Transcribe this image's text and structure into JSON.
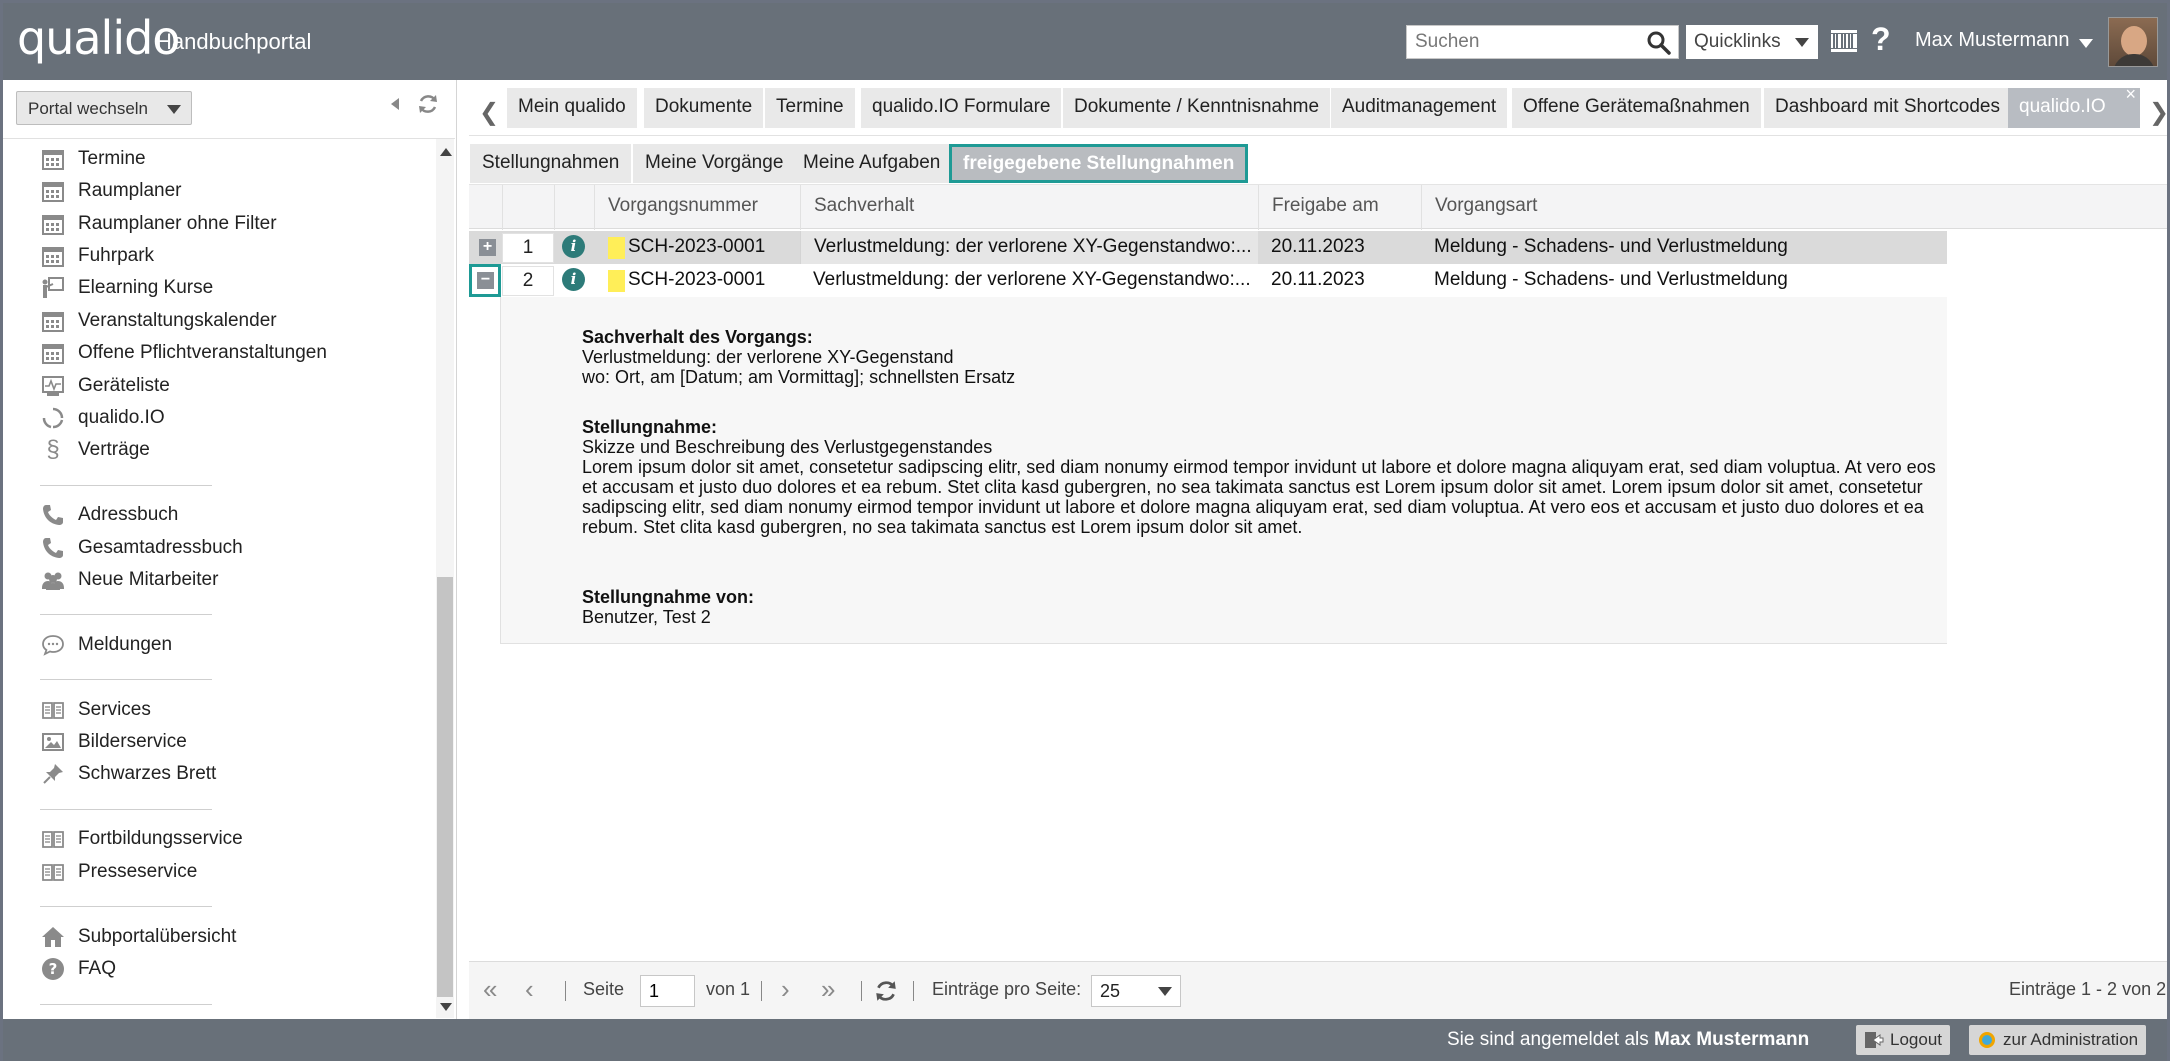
{
  "header": {
    "logo": "qualido",
    "portal_name": "Handbuchportal",
    "search_placeholder": "Suchen",
    "quicklinks_label": "Quicklinks",
    "help_label": "?",
    "user_name": "Max Mustermann"
  },
  "sidebar": {
    "portal_switch_label": "Portal wechseln",
    "items": [
      {
        "label": "Termine",
        "icon": "calendar-icon"
      },
      {
        "label": "Raumplaner",
        "icon": "calendar-icon"
      },
      {
        "label": "Raumplaner ohne Filter",
        "icon": "calendar-icon"
      },
      {
        "label": "Fuhrpark",
        "icon": "calendar-icon"
      },
      {
        "label": "Elearning Kurse",
        "icon": "presentation-icon"
      },
      {
        "label": "Veranstaltungskalender",
        "icon": "calendar-icon"
      },
      {
        "label": "Offene Pflichtveranstaltungen",
        "icon": "calendar-icon"
      },
      {
        "label": "Geräteliste",
        "icon": "monitor-icon"
      },
      {
        "label": "qualido.IO",
        "icon": "circle-arrows-icon"
      },
      {
        "label": "Verträge",
        "icon": "paragraph-icon"
      },
      {
        "label": "Adressbuch",
        "icon": "phone-icon"
      },
      {
        "label": "Gesamtadressbuch",
        "icon": "phone-icon"
      },
      {
        "label": "Neue Mitarbeiter",
        "icon": "people-icon"
      },
      {
        "label": "Meldungen",
        "icon": "chat-bubble-icon"
      },
      {
        "label": "Services",
        "icon": "book-icon"
      },
      {
        "label": "Bilderservice",
        "icon": "image-icon"
      },
      {
        "label": "Schwarzes Brett",
        "icon": "pin-icon"
      },
      {
        "label": "Fortbildungsservice",
        "icon": "book-icon"
      },
      {
        "label": "Presseservice",
        "icon": "book-icon"
      },
      {
        "label": "Subportalübersicht",
        "icon": "home-icon"
      },
      {
        "label": "FAQ",
        "icon": "question-circle-icon"
      }
    ]
  },
  "tabs": [
    {
      "label": "Mein qualido"
    },
    {
      "label": "Dokumente"
    },
    {
      "label": "Termine"
    },
    {
      "label": "qualido.IO Formulare"
    },
    {
      "label": "Dokumente / Kenntnisnahme"
    },
    {
      "label": "Auditmanagement"
    },
    {
      "label": "Offene Gerätemaßnahmen"
    },
    {
      "label": "Dashboard mit Shortcodes"
    },
    {
      "label": "qualido.IO",
      "active": true
    }
  ],
  "subtabs": [
    {
      "label": "Stellungnahmen"
    },
    {
      "label": "Meine Vorgänge"
    },
    {
      "label": "Meine Aufgaben"
    },
    {
      "label": "freigegebene Stellungnahmen",
      "active": true
    }
  ],
  "grid": {
    "columns": [
      "Vorgangsnummer",
      "Sachverhalt",
      "Freigabe am",
      "Vorgangsart"
    ],
    "rows": [
      {
        "num": "1",
        "vorgangsnummer": "SCH-2023-0001",
        "sachverhalt": "Verlustmeldung: der verlorene XY-Gegenstandwo:...",
        "freigabe": "20.11.2023",
        "vorgangsart": "Meldung - Schadens- und Verlustmeldung",
        "expanded": false
      },
      {
        "num": "2",
        "vorgangsnummer": "SCH-2023-0001",
        "sachverhalt": "Verlustmeldung: der verlorene XY-Gegenstandwo:...",
        "freigabe": "20.11.2023",
        "vorgangsart": "Meldung - Schadens- und Verlustmeldung",
        "expanded": true
      }
    ],
    "expand_symbol": "+",
    "collapse_symbol": "−",
    "info_symbol": "i",
    "detail": {
      "sachverhalt_label": "Sachverhalt des Vorgangs:",
      "sachverhalt_line1": "Verlustmeldung: der verlorene XY-Gegenstand",
      "sachverhalt_line2": "wo: Ort, am [Datum; am Vormittag]; schnellsten Ersatz",
      "stellungnahme_label": "Stellungnahme:",
      "stellungnahme_line1": "Skizze und Beschreibung des Verlustgegenstandes",
      "stellungnahme_body": "Lorem ipsum dolor sit amet, consetetur sadipscing elitr, sed diam nonumy eirmod tempor invidunt ut labore et dolore magna aliquyam erat, sed diam voluptua. At vero eos et accusam et justo duo dolores et ea rebum. Stet clita kasd gubergren, no sea takimata sanctus est Lorem ipsum dolor sit amet. Lorem ipsum dolor sit amet, consetetur sadipscing elitr, sed diam nonumy eirmod tempor invidunt ut labore et dolore magna aliquyam erat, sed diam voluptua. At vero eos et accusam et justo duo dolores et ea rebum. Stet clita kasd gubergren, no sea takimata sanctus est Lorem ipsum dolor sit amet.",
      "von_label": "Stellungnahme von:",
      "von_value": "Benutzer, Test 2"
    }
  },
  "pager": {
    "first": "«",
    "prev": "‹",
    "next": "›",
    "last": "»",
    "seite_label": "Seite",
    "page_value": "1",
    "von_label": "von 1",
    "eintraege_label": "Einträge pro Seite:",
    "per_page_value": "25",
    "summary": "Einträge 1 - 2 von 2"
  },
  "footer": {
    "logged_in_prefix": "Sie sind angemeldet als",
    "logged_in_user": "Max Mustermann",
    "logout_label": "Logout",
    "admin_label": "zur Administration"
  },
  "colors": {
    "header_bg": "#687079",
    "accent_teal": "#1e9a95",
    "marker_yellow": "#ffee58",
    "info_icon": "#2d7b79"
  }
}
